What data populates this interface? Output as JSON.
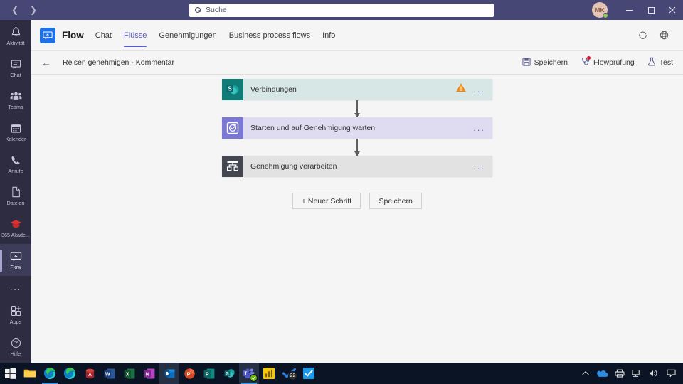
{
  "titlebar": {
    "back_icon": "chevron-left-icon",
    "forward_icon": "chevron-right-icon",
    "search_placeholder": "Suche",
    "avatar_initials": "MK",
    "minimize_label": "Minimieren",
    "maximize_label": "Maximieren",
    "close_label": "Schließen"
  },
  "rail": {
    "items": [
      {
        "label": "Aktivität",
        "icon": "bell-icon"
      },
      {
        "label": "Chat",
        "icon": "chat-icon"
      },
      {
        "label": "Teams",
        "icon": "teams-icon"
      },
      {
        "label": "Kalender",
        "icon": "calendar-icon"
      },
      {
        "label": "Anrufe",
        "icon": "phone-icon"
      },
      {
        "label": "Dateien",
        "icon": "file-icon"
      },
      {
        "label": "365 Akade...",
        "icon": "graduation-cap-icon"
      },
      {
        "label": "Flow",
        "icon": "flow-icon"
      }
    ],
    "more_label": "...",
    "bottom": [
      {
        "label": "Apps",
        "icon": "apps-icon"
      },
      {
        "label": "Hilfe",
        "icon": "help-icon"
      }
    ]
  },
  "appheader": {
    "title": "Flow",
    "logo_icon": "flow-app-icon",
    "tabs": [
      {
        "label": "Chat",
        "active": false
      },
      {
        "label": "Flüsse",
        "active": true
      },
      {
        "label": "Genehmigungen",
        "active": false
      },
      {
        "label": "Business process flows",
        "active": false
      },
      {
        "label": "Info",
        "active": false
      }
    ],
    "right_icons": [
      {
        "name": "refresh-icon"
      },
      {
        "name": "globe-icon"
      }
    ]
  },
  "commandbar": {
    "back_icon": "arrow-left-icon",
    "breadcrumb": "Reisen genehmigen - Kommentar",
    "actions": [
      {
        "label": "Speichern",
        "icon": "save-icon",
        "badge": false
      },
      {
        "label": "Flowprüfung",
        "icon": "stethoscope-icon",
        "badge": true
      },
      {
        "label": "Test",
        "icon": "flask-icon",
        "badge": false
      }
    ]
  },
  "flow": {
    "steps": [
      {
        "title": "Verbindungen",
        "icon": "sharepoint-icon",
        "color": "#d7e7e5",
        "warning": true,
        "menu": "..."
      },
      {
        "title": "Starten und auf Genehmigung warten",
        "icon": "approvals-icon",
        "color": "#dfdcf2",
        "warning": false,
        "menu": "..."
      },
      {
        "title": "Genehmigung verarbeiten",
        "icon": "control-icon",
        "color": "#e2e2e2",
        "warning": false,
        "menu": "..."
      }
    ],
    "buttons": [
      {
        "label": "+ Neuer Schritt"
      },
      {
        "label": "Speichern"
      }
    ]
  },
  "taskbar": {
    "items": [
      {
        "name": "start-button",
        "icon": "windows-logo"
      },
      {
        "name": "file-explorer",
        "icon": "folder-icon"
      },
      {
        "name": "microsoft-edge",
        "icon": "edge-icon",
        "running": true
      },
      {
        "name": "microsoft-edge-2",
        "icon": "edge-icon"
      },
      {
        "name": "microsoft-access",
        "icon": "access-icon"
      },
      {
        "name": "microsoft-word",
        "icon": "word-icon"
      },
      {
        "name": "microsoft-excel",
        "icon": "excel-icon"
      },
      {
        "name": "microsoft-onenote",
        "icon": "onenote-icon"
      },
      {
        "name": "microsoft-outlook",
        "icon": "outlook-icon",
        "focused": true
      },
      {
        "name": "microsoft-powerpoint",
        "icon": "powerpoint-icon"
      },
      {
        "name": "microsoft-publisher",
        "icon": "publisher-icon"
      },
      {
        "name": "microsoft-sharepoint",
        "icon": "sharepoint-taskbar-icon"
      },
      {
        "name": "microsoft-teams",
        "icon": "teams-taskbar-icon",
        "running": true,
        "focused": true,
        "check": true
      },
      {
        "name": "power-bi",
        "icon": "powerbi-icon"
      },
      {
        "name": "microsoft-todo",
        "icon": "todo-icon",
        "badge": "22"
      },
      {
        "name": "microsoft-onenote-2",
        "icon": "onenote-check-icon"
      }
    ],
    "tray": [
      {
        "name": "show-hidden-icons",
        "icon": "chevron-up-icon"
      },
      {
        "name": "onedrive",
        "icon": "cloud-icon"
      },
      {
        "name": "fax-printer",
        "icon": "printer-icon"
      },
      {
        "name": "network",
        "icon": "network-icon"
      },
      {
        "name": "volume",
        "icon": "speaker-icon"
      },
      {
        "name": "action-center",
        "icon": "notification-icon"
      }
    ]
  }
}
